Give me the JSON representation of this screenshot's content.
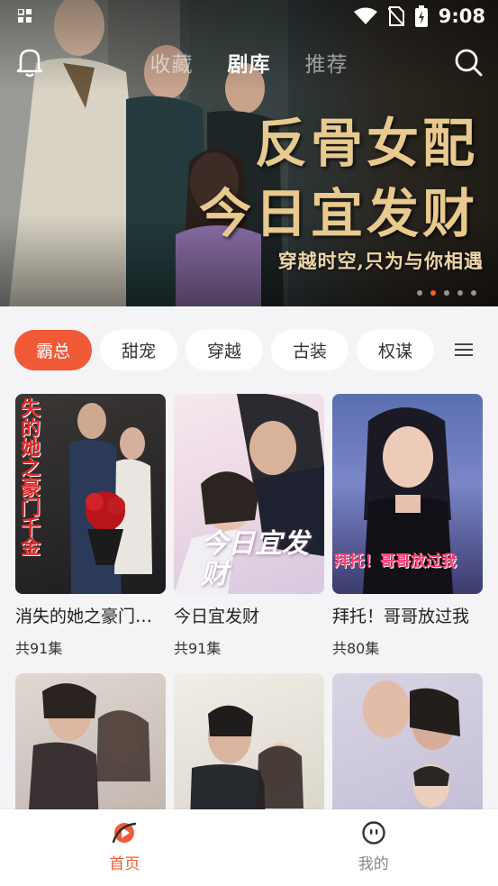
{
  "status_bar": {
    "time": "9:08"
  },
  "header": {
    "tabs": [
      {
        "label": "收藏",
        "active": false
      },
      {
        "label": "剧库",
        "active": true
      },
      {
        "label": "推荐",
        "active": false
      }
    ]
  },
  "banner": {
    "title_line1": "反骨女配",
    "title_line2": "今日宜发财",
    "subtitle": "穿越时空,只为与你相遇",
    "slide_count": 5,
    "active_slide": 2
  },
  "categories": {
    "items": [
      "霸总",
      "甜宠",
      "穿越",
      "古装",
      "权谋"
    ],
    "active_index": 0
  },
  "dramas": [
    {
      "title": "消失的她之豪门…",
      "count": "共91集",
      "poster_text": "失的她之豪门千金"
    },
    {
      "title": "今日宜发财",
      "count": "共91集",
      "poster_text": "今日宜发财"
    },
    {
      "title": "拜托！哥哥放过我",
      "count": "共80集",
      "poster_text": "拜托！哥哥放过我"
    },
    {
      "title": "",
      "count": ""
    },
    {
      "title": "",
      "count": ""
    },
    {
      "title": "",
      "count": ""
    }
  ],
  "bottom_nav": {
    "home_label": "首页",
    "mine_label": "我的"
  },
  "colors": {
    "accent": "#f05a37",
    "banner_gold": "#e8c98e"
  }
}
